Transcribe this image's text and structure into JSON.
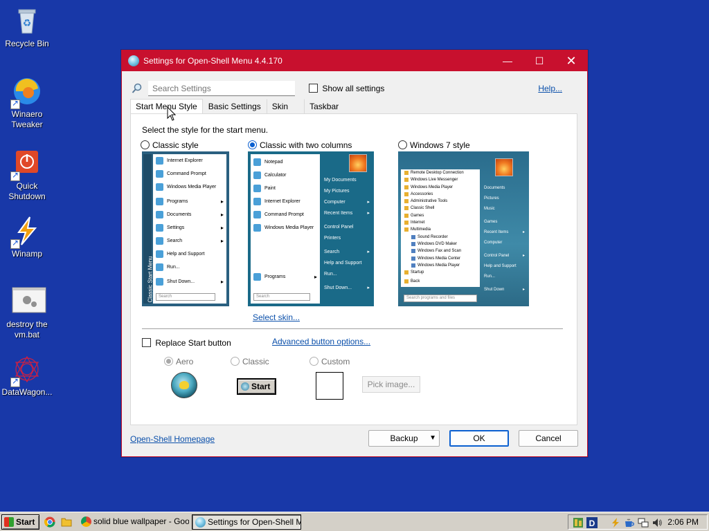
{
  "desktop": {
    "icons": [
      {
        "label": "Recycle Bin"
      },
      {
        "label": "Winaero Tweaker"
      },
      {
        "label": "Quick Shutdown"
      },
      {
        "label": "Winamp"
      },
      {
        "label": "destroy the vm.bat"
      },
      {
        "label": "DataWagon..."
      }
    ],
    "background_color": "#1838a8"
  },
  "dialog": {
    "title": "Settings for Open-Shell Menu 4.4.170",
    "accent_color": "#c8102e",
    "search": {
      "placeholder": "Search Settings"
    },
    "show_all_label": "Show all settings",
    "help_label": "Help...",
    "tabs": [
      {
        "label": "Start Menu Style",
        "active": true
      },
      {
        "label": "Basic Settings"
      },
      {
        "label": "Skin"
      },
      {
        "label": "Taskbar"
      }
    ],
    "instruction": "Select the style for the start menu.",
    "styles": [
      {
        "label": "Classic style",
        "selected": false
      },
      {
        "label": "Classic with two columns",
        "selected": true
      },
      {
        "label": "Windows 7 style",
        "selected": false
      }
    ],
    "preview_classic": {
      "strip_label": "Classic Start Menu",
      "items": [
        "Internet Explorer",
        "Command Prompt",
        "Windows Media Player",
        "Programs",
        "Documents",
        "Settings",
        "Search",
        "Help and Support",
        "Run...",
        "Shut Down..."
      ],
      "search_placeholder": "Search"
    },
    "preview_two": {
      "left_items": [
        "Notepad",
        "Calculator",
        "Paint",
        "Internet Explorer",
        "Command Prompt",
        "Windows Media Player"
      ],
      "programs_label": "Programs",
      "search_placeholder": "Search",
      "right_items": [
        "My Documents",
        "My Pictures",
        "Computer",
        "Recent Items",
        "Control Panel",
        "Printers",
        "Search",
        "Help and Support",
        "Run...",
        "Shut Down..."
      ]
    },
    "preview_win7": {
      "left_items": [
        "Remote Desktop Connection",
        "Windows Live Messenger",
        "Windows Media Player",
        "Accessories",
        "Administrative Tools",
        "Classic Shell",
        "Games",
        "Internet",
        "Multimedia"
      ],
      "sub_items": [
        "Sound Recorder",
        "Windows DVD Maker",
        "Windows Fax and Scan",
        "Windows Media Center",
        "Windows Media Player"
      ],
      "startup_label": "Startup",
      "back_label": "Back",
      "search_placeholder": "Search programs and files",
      "right_items": [
        "Documents",
        "Pictures",
        "Music",
        "Games",
        "Recent Items",
        "Computer",
        "Control Panel",
        "Help and Support",
        "Run..."
      ],
      "shutdown_label": "Shut Down"
    },
    "select_skin_label": "Select skin...",
    "replace_start_label": "Replace Start button",
    "advanced_button_label": "Advanced button options...",
    "button_styles": [
      {
        "label": "Aero",
        "selected": true
      },
      {
        "label": "Classic"
      },
      {
        "label": "Custom"
      }
    ],
    "classic_button_text": "Start",
    "pick_image_label": "Pick image...",
    "homepage_label": "Open-Shell Homepage",
    "backup_label": "Backup",
    "ok_label": "OK",
    "cancel_label": "Cancel"
  },
  "taskbar": {
    "start_label": "Start",
    "tasks": [
      {
        "label": "solid blue wallpaper - Goo..."
      },
      {
        "label": "Settings for Open-Shell M..."
      }
    ],
    "clock": "2:06 PM"
  }
}
